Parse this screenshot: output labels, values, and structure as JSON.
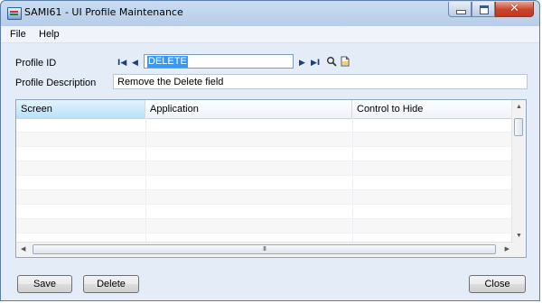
{
  "window": {
    "title": "SAMI61 - UI Profile Maintenance",
    "close_glyph": "✕"
  },
  "menu": [
    "File",
    "Help"
  ],
  "form": {
    "profile_id_label": "Profile ID",
    "profile_id_value": "DELETE",
    "profile_description_label": "Profile Description",
    "profile_description_value": "Remove the Delete field",
    "nav_first": "I◀",
    "nav_prev": "◀",
    "nav_next": "▶",
    "nav_last": "▶I"
  },
  "grid": {
    "columns": [
      "Screen",
      "Application",
      "Control to Hide"
    ],
    "rows": 9,
    "scroll_grip": "III"
  },
  "buttons": {
    "save": "Save",
    "delete": "Delete",
    "close": "Close"
  },
  "icons": [
    "app-icon",
    "minimize-icon",
    "maximize-icon",
    "close-icon",
    "first-record-icon",
    "previous-record-icon",
    "next-record-icon",
    "last-record-icon",
    "search-icon",
    "new-document-icon"
  ]
}
